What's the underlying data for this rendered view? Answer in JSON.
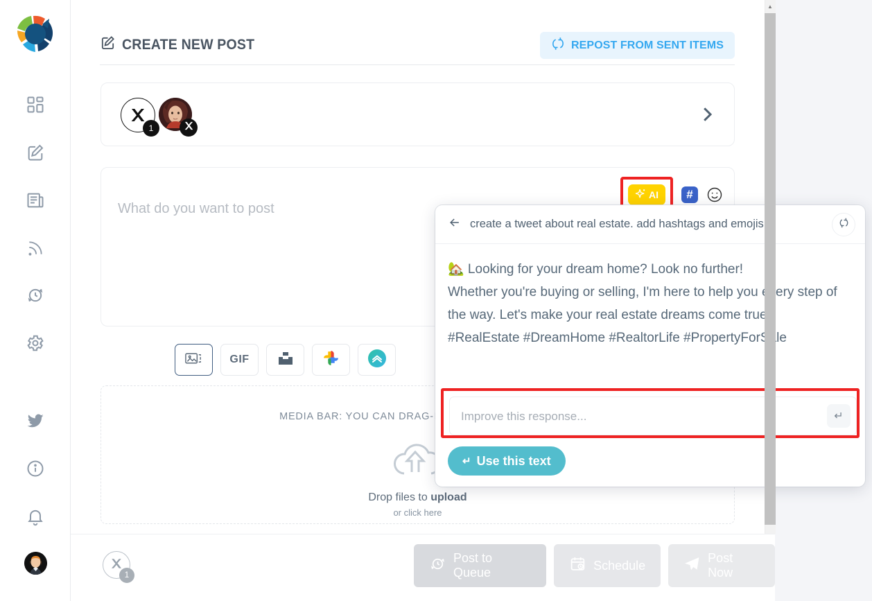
{
  "app": {
    "brand_logo": "circular-segmented-logo"
  },
  "sidebar": {
    "items": [
      {
        "name": "dashboard",
        "icon": "grid-icon"
      },
      {
        "name": "compose",
        "icon": "pencil-square-icon"
      },
      {
        "name": "content",
        "icon": "newspaper-icon"
      },
      {
        "name": "feeds",
        "icon": "rss-icon"
      },
      {
        "name": "queue",
        "icon": "clock-refresh-icon"
      },
      {
        "name": "settings",
        "icon": "gear-icon"
      },
      {
        "name": "twitter",
        "icon": "twitter-bird-icon"
      },
      {
        "name": "info",
        "icon": "info-circle-icon"
      },
      {
        "name": "notifications",
        "icon": "bell-icon"
      }
    ],
    "avatar_alt": "user-avatar"
  },
  "header": {
    "title": "CREATE NEW POST",
    "title_icon": "pencil-square-icon",
    "repost_label": "REPOST FROM SENT ITEMS",
    "repost_icon": "repost-refresh-icon"
  },
  "account_selector": {
    "x_icon": "x-twitter-icon",
    "count_badge": "1",
    "avatar_alt": "account-avatar",
    "avatar_badge_icon": "x-twitter-icon",
    "expand_icon": "chevron-right-icon"
  },
  "composer": {
    "placeholder": "What do you want to post",
    "value": "",
    "tools": {
      "ai_label": "AI",
      "ai_icon": "sparkle-icon",
      "hashtag_label": "#",
      "emoji_icon": "smiley-icon"
    }
  },
  "media_toolbar": {
    "buttons": [
      {
        "name": "images",
        "icon": "image-stack-icon",
        "label": "",
        "selected": true
      },
      {
        "name": "gif",
        "icon": "gif-icon",
        "label": "GIF",
        "selected": false
      },
      {
        "name": "unsplash",
        "icon": "unsplash-icon",
        "label": "",
        "selected": false
      },
      {
        "name": "google-photos",
        "icon": "google-photos-icon",
        "label": "",
        "selected": false
      },
      {
        "name": "upload-cloud",
        "icon": "upload-chevron-icon",
        "label": "",
        "selected": false
      }
    ]
  },
  "dropzone": {
    "bar_label": "MEDIA BAR: YOU CAN DRAG-N-DROP IMAGES HERE",
    "icon": "cloud-upload-icon",
    "drop_prefix": "Drop files to ",
    "drop_strong": "upload",
    "click_text": "or click here"
  },
  "ai_panel": {
    "back_icon": "arrow-left-icon",
    "prompt": "create a tweet about real estate. add hashtags and emojis....",
    "refresh_icon": "refresh-icon",
    "response": "🏡 Looking for your dream home? Look no further!\nWhether you're buying or selling, I'm here to help you every step of the way. Let's make your real estate dreams come true!\n#RealEstate #DreamHome #RealtorLife #PropertyForSale",
    "improve_placeholder": "Improve this response...",
    "improve_value": "",
    "enter_icon": "enter-return-icon",
    "use_label": "Use this text",
    "use_icon": "enter-return-icon",
    "highlight_color": "#ee2222"
  },
  "footer": {
    "account_icon": "x-twitter-icon",
    "account_badge": "1",
    "buttons": [
      {
        "name": "post-to-queue",
        "label": "Post to Queue",
        "icon": "queue-clock-icon",
        "disabled": true
      },
      {
        "name": "schedule",
        "label": "Schedule",
        "icon": "calendar-clock-icon",
        "disabled": true
      },
      {
        "name": "post-now",
        "label": "Post Now",
        "icon": "paper-plane-icon",
        "disabled": true
      }
    ]
  },
  "scrollbar": {
    "up_arrow": "▲",
    "position": "top"
  },
  "colors": {
    "accent_blue": "#35a8f0",
    "ai_yellow": "#ffd300",
    "teal": "#53bdcd",
    "hashtag_blue": "#3a62c8",
    "highlight_red": "#ee2222",
    "text": "#4f6070"
  }
}
